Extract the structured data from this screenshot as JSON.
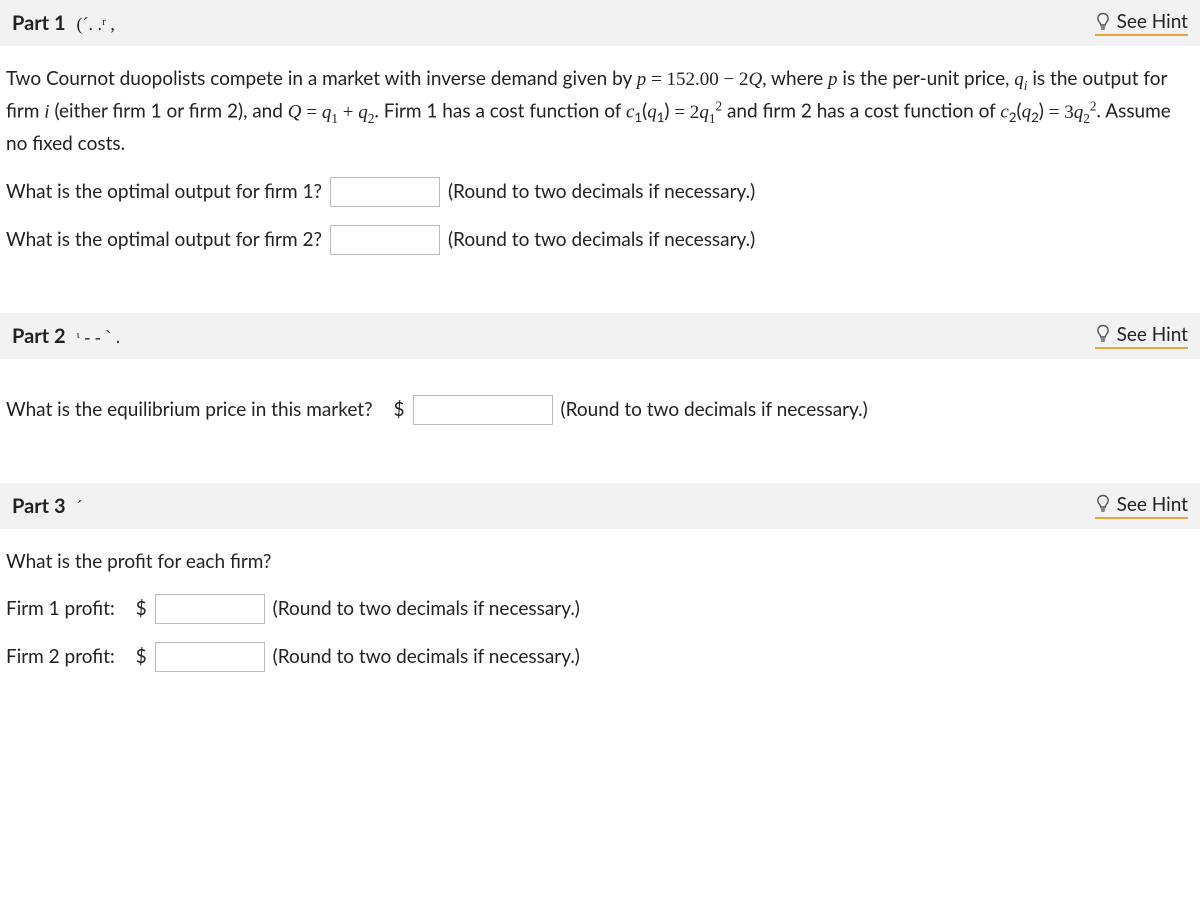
{
  "hint_label": "See Hint",
  "round_note": "(Round to two decimals if necessary.)",
  "part1": {
    "title": "Part 1",
    "sub": "(´. .ʳ       ,",
    "problem_html": "Two Cournot duopolists compete in a market with inverse demand given by <span class='mathit'>p</span> <span class='eq'>= 152.00 − 2<span class='mathit'>Q</span></span>, where <span class='mathit'>p</span> is the per-unit price, <span class='mathit'>q<span class='sub1'>i</span></span> is the output for firm <span class='mathit'>i</span> (either firm 1 or firm 2), and <span class='mathit'>Q</span> <span class='eq'>= <span class='mathit'>q</span><span class='sub1'>1</span> + <span class='mathit'>q</span><span class='sub1'>2</span></span>. Firm 1 has a cost function of <span class='mathit'>c</span><span class='sub1'>1</span>(<span class='mathit'>q</span><span class='sub1'>1</span>) <span class='eq'>= 2<span class='mathit'>q</span><span class='sub1'>1</span><span class='sup1'>2</span></span> and firm 2 has a cost function of <span class='mathit'>c</span><span class='sub1'>2</span>(<span class='mathit'>q</span><span class='sub1'>2</span>) <span class='eq'>= 3<span class='mathit'>q</span><span class='sub1'>2</span><span class='sup1'>2</span></span>. Assume no fixed costs.",
    "q1_label": "What is the optimal output for firm 1?",
    "q2_label": "What is the optimal output for firm 2?"
  },
  "part2": {
    "title": "Part 2",
    "sub": "ᶥ - -  `     .",
    "q_label": "What is the equilibrium price in this market?",
    "currency": "$"
  },
  "part3": {
    "title": "Part 3",
    "sub": "´",
    "q_label": "What is the profit for each firm?",
    "firm1_label": "Firm 1 profit:",
    "firm2_label": "Firm 2 profit:",
    "currency": "$"
  }
}
